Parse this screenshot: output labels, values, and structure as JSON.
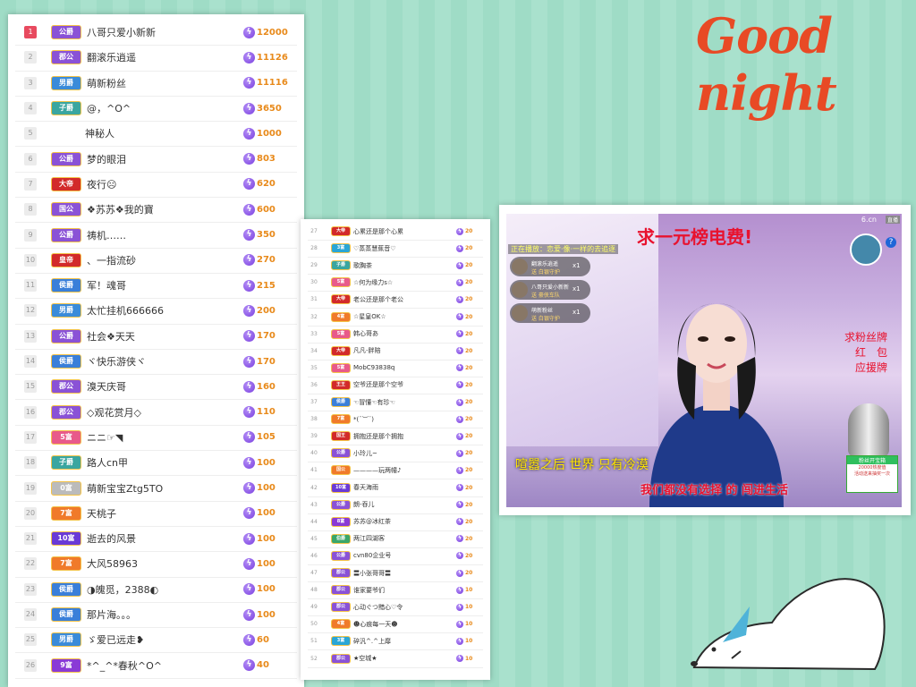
{
  "greeting": "Good night",
  "leaderboard_main": [
    {
      "rank": "1",
      "badge": "公爵",
      "color": "#8a52d6",
      "name": "八哥只爱小新新",
      "score": "12000"
    },
    {
      "rank": "2",
      "badge": "郡公",
      "color": "#8a52d6",
      "name": "翻滚乐逍遥",
      "score": "11126"
    },
    {
      "rank": "3",
      "badge": "男爵",
      "color": "#3a8bd9",
      "name": "萌新粉丝",
      "score": "11116"
    },
    {
      "rank": "4",
      "badge": "子爵",
      "color": "#3aa6a0",
      "name": "@，^O^",
      "score": "3650"
    },
    {
      "rank": "5",
      "badge": "",
      "color": "",
      "name": "神秘人",
      "score": "1000"
    },
    {
      "rank": "6",
      "badge": "公爵",
      "color": "#8a52d6",
      "name": "梦的眼泪",
      "score": "803"
    },
    {
      "rank": "7",
      "badge": "大帝",
      "color": "#d22a2a",
      "name": "夜行☹",
      "score": "620"
    },
    {
      "rank": "8",
      "badge": "国公",
      "color": "#8a52d6",
      "name": "❖苏苏❖我的寶",
      "score": "600"
    },
    {
      "rank": "9",
      "badge": "公爵",
      "color": "#8a52d6",
      "name": "祷机……",
      "score": "350"
    },
    {
      "rank": "10",
      "badge": "皇帝",
      "color": "#d22a2a",
      "name": "、一指流砂",
      "score": "270"
    },
    {
      "rank": "11",
      "badge": "侯爵",
      "color": "#3a7fd9",
      "name": "军！魂哥",
      "score": "215"
    },
    {
      "rank": "12",
      "badge": "男爵",
      "color": "#3a8bd9",
      "name": "太忙挂机666666",
      "score": "200"
    },
    {
      "rank": "13",
      "badge": "公爵",
      "color": "#8a52d6",
      "name": "社会❖天天",
      "score": "170"
    },
    {
      "rank": "14",
      "badge": "侯爵",
      "color": "#3a7fd9",
      "name": "ヾ快乐游侠ヾ",
      "score": "170"
    },
    {
      "rank": "15",
      "badge": "郡公",
      "color": "#8a52d6",
      "name": "溴天庆哥",
      "score": "160"
    },
    {
      "rank": "16",
      "badge": "郡公",
      "color": "#8a52d6",
      "name": "◇观花赏月◇",
      "score": "110"
    },
    {
      "rank": "17",
      "badge": "5富",
      "color": "#e85a8a",
      "name": "ニニ☞◥",
      "score": "105"
    },
    {
      "rank": "18",
      "badge": "子爵",
      "color": "#3aa6a0",
      "name": "路人cn甲",
      "score": "100"
    },
    {
      "rank": "19",
      "badge": "0富",
      "color": "#bbbbbb",
      "name": "萌新宝宝Ztg5TO",
      "score": "100"
    },
    {
      "rank": "20",
      "badge": "7富",
      "color": "#f07a2a",
      "name": "天桃子",
      "score": "100"
    },
    {
      "rank": "21",
      "badge": "10富",
      "color": "#6a3ad6",
      "name": "逝去的风景",
      "score": "100"
    },
    {
      "rank": "22",
      "badge": "7富",
      "color": "#f07a2a",
      "name": "大风58963",
      "score": "100"
    },
    {
      "rank": "23",
      "badge": "侯爵",
      "color": "#3a7fd9",
      "name": "◑魄觅，2388◐",
      "score": "100"
    },
    {
      "rank": "24",
      "badge": "侯爵",
      "color": "#3a7fd9",
      "name": "那片海。。。",
      "score": "100"
    },
    {
      "rank": "25",
      "badge": "男爵",
      "color": "#3a8bd9",
      "name": "ゞ爱已远走❥",
      "score": "60"
    },
    {
      "rank": "26",
      "badge": "9富",
      "color": "#8a3ad6",
      "name": "*^_^*春秋^O^",
      "score": "40"
    }
  ],
  "leaderboard_small": [
    {
      "rank": "27",
      "badge": "大帝",
      "color": "#d22a2a",
      "name": "心累还是那个心累",
      "score": "20"
    },
    {
      "rank": "28",
      "badge": "3富",
      "color": "#2aa6d6",
      "name": "♡蒸蒸慧蕉音♡",
      "score": "20"
    },
    {
      "rank": "29",
      "badge": "子爵",
      "color": "#3aa6a0",
      "name": "歌胸茶",
      "score": "20"
    },
    {
      "rank": "30",
      "badge": "5富",
      "color": "#e85a8a",
      "name": "☆何为缘力s☆",
      "score": "20"
    },
    {
      "rank": "31",
      "badge": "大帝",
      "color": "#d22a2a",
      "name": "老公还是那个老公",
      "score": "20"
    },
    {
      "rank": "32",
      "badge": "4富",
      "color": "#f07a2a",
      "name": "☆星皇OK☆",
      "score": "20"
    },
    {
      "rank": "33",
      "badge": "5富",
      "color": "#e85a8a",
      "name": "韩心哥あ",
      "score": "20"
    },
    {
      "rank": "34",
      "badge": "大帝",
      "color": "#d22a2a",
      "name": "凡凡-胖陪",
      "score": "20"
    },
    {
      "rank": "35",
      "badge": "5富",
      "color": "#e85a8a",
      "name": "MobC93838q",
      "score": "20"
    },
    {
      "rank": "36",
      "badge": "王王",
      "color": "#d22a2a",
      "name": "空爷还是那个空爷",
      "score": "20"
    },
    {
      "rank": "37",
      "badge": "侯爵",
      "color": "#3a7fd9",
      "name": "☜冒懂☜有珍☜",
      "score": "20"
    },
    {
      "rank": "38",
      "badge": "7富",
      "color": "#f07a2a",
      "name": "*(¨︶¨)",
      "score": "20"
    },
    {
      "rank": "39",
      "badge": "国王",
      "color": "#d22a2a",
      "name": "拥抱还是那个拥抱",
      "score": "20"
    },
    {
      "rank": "40",
      "badge": "公爵",
      "color": "#8a52d6",
      "name": "小玲儿~",
      "score": "20"
    },
    {
      "rank": "41",
      "badge": "国公",
      "color": "#f07a2a",
      "name": "————玩两幢♪",
      "score": "20"
    },
    {
      "rank": "42",
      "badge": "10富",
      "color": "#6a3ad6",
      "name": "春天海雨",
      "score": "20"
    },
    {
      "rank": "43",
      "badge": "公爵",
      "color": "#8a52d6",
      "name": "朗-吞儿",
      "score": "20"
    },
    {
      "rank": "44",
      "badge": "8富",
      "color": "#8a3ad6",
      "name": "苏苏@冰红茶",
      "score": "20"
    },
    {
      "rank": "45",
      "badge": "伯爵",
      "color": "#3aa66a",
      "name": "两江四湖客",
      "score": "20"
    },
    {
      "rank": "46",
      "badge": "公爵",
      "color": "#8a52d6",
      "name": "cvn80企业号",
      "score": "20"
    },
    {
      "rank": "47",
      "badge": "郡公",
      "color": "#8a52d6",
      "name": "〓小张哥哥〓",
      "score": "20"
    },
    {
      "rank": "48",
      "badge": "郡公",
      "color": "#8a52d6",
      "name": "谁家要爷们",
      "score": "10"
    },
    {
      "rank": "49",
      "badge": "郡公",
      "color": "#8a52d6",
      "name": "心动ぐつ黯心♡令",
      "score": "10"
    },
    {
      "rank": "50",
      "badge": "4富",
      "color": "#f07a2a",
      "name": "☻心痕每一天☻",
      "score": "10"
    },
    {
      "rank": "51",
      "badge": "3富",
      "color": "#2aa6d6",
      "name": "碎汎^.^上靡",
      "score": "10"
    },
    {
      "rank": "52",
      "badge": "郡公",
      "color": "#8a52d6",
      "name": "★空城★",
      "score": "10"
    }
  ],
  "stream": {
    "banner": "求一元榜电费!",
    "watermark": "6.cn",
    "watermark_btn": "直播",
    "notice": "正在播放：恋爱·像·一样的去追逐",
    "gifts": [
      {
        "name": "翻滚乐逍遥",
        "sub": "送 白银守护",
        "count": "x1"
      },
      {
        "name": "八哥只爱小新新",
        "sub": "送 豪侠车队",
        "count": "x1"
      },
      {
        "name": "萌新粉丝",
        "sub": "送 白银守护",
        "count": "x1"
      }
    ],
    "requests": [
      "求粉丝牌",
      "红　包",
      "应援牌"
    ],
    "help": "?",
    "fan_title": "粉丝开宝箱",
    "fan_line1": "20000热度值",
    "fan_line2": "活动送来抽奖一次",
    "lyric1": "喧嚣之后 世界 只有冷漠",
    "lyric2": "我们都没有选择 的 闯进生活"
  }
}
